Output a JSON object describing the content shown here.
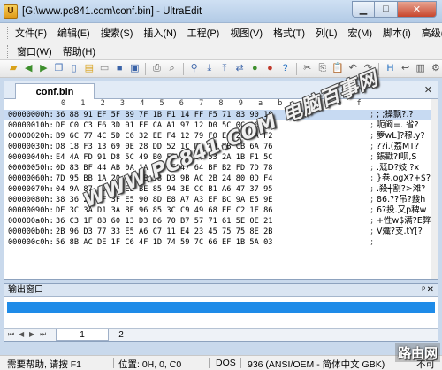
{
  "window": {
    "title": "[G:\\www.pc841.com\\conf.bin] - UltraEdit"
  },
  "menus": {
    "row1": [
      "文件(F)",
      "编辑(E)",
      "搜索(S)",
      "插入(N)",
      "工程(P)",
      "视图(V)",
      "格式(T)",
      "列(L)",
      "宏(M)",
      "脚本(i)",
      "高级(A)"
    ],
    "row2": [
      "窗口(W)",
      "帮助(H)"
    ]
  },
  "document": {
    "tab_label": "conf.bin",
    "ruler": [
      "0",
      "1",
      "2",
      "3",
      "4",
      "5",
      "6",
      "7",
      "8",
      "9",
      "a",
      "b",
      "c",
      "d",
      "e",
      "f"
    ],
    "rows": [
      {
        "addr": "00000000h:",
        "bytes": "36 88 91 EF 5F 89 7F 1B F1 14 FF F5 71 83 90 18",
        "ascii": "; ;操飘?.?"
      },
      {
        "addr": "00000010h:",
        "bytes": "DF C0 C3 F6 3D 01 FF CA A1 97 12 D0 5C 0C A6 32",
        "ascii": "呃阚=. 省?"
      },
      {
        "addr": "00000020h:",
        "bytes": "B9 6C 77 4C 5D C6 32 EE F4 12 79 F0 EC 20 6A F2",
        "ascii": "箩wL]?穆.y?"
      },
      {
        "addr": "00000030h:",
        "bytes": "D8 18 F3 13 69 0E 28 DD 52 1C D9 4D DB CB 6A 76",
        "ascii": "??i.(荔MT?"
      },
      {
        "addr": "00000040h:",
        "bytes": "E4 4A FD 91 D8 5C 49 B0 FB 4E 2C 53 2A 1B F1 5C",
        "ascii": "鋹戳?I呗,S"
      },
      {
        "addr": "00000050h:",
        "bytes": "0D 83 BF 44 AB 0A 1A 8E CE 47 64 BF B2 FD 7D 78",
        "ascii": ".兓D?妓 ?x"
      },
      {
        "addr": "00000060h:",
        "bytes": "7D 95 BB 1A 20 56 8B 58 D3 9B AC 2B 24 80 0D F4",
        "ascii": "}卷.ogX?+$?"
      },
      {
        "addr": "00000070h:",
        "bytes": "04 9A 87 A9 A8 EE BE 85 94 3E CC B1 A6 47 37 95",
        "ascii": ".殺┽割?>滩?"
      },
      {
        "addr": "00000080h:",
        "bytes": "38 36 2E 3F 3F E5 90 8D E8 A7 A3 EF BC 9A E5 9E",
        "ascii": "86.??吊?鼗h"
      },
      {
        "addr": "00000090h:",
        "bytes": "DE 3C 3A D1 3A 8E 96 85 3C C9 49 68 EE C2 1F 86",
        "ascii": "6?投.又p稗w"
      },
      {
        "addr": "000000a0h:",
        "bytes": "36 C3 1F 88 60 13 D3 D6 70 B7 57 71 61 5E 0E 21",
        "ascii": "+性w$满?E弊"
      },
      {
        "addr": "000000b0h:",
        "bytes": "2B 96 D3 77 33 E5 A6 C7 11 E4 23 45 75 75 8E 2B",
        "ascii": "V殲?支.tY[?"
      },
      {
        "addr": "000000c0h:",
        "bytes": "56 8B AC DE 1F C6 4F 1D 74 59 7C 66 EF 1B 5A 03",
        "ascii": ""
      }
    ]
  },
  "watermark": "WWW.PC841.COM 电脑百事网",
  "output": {
    "title": "输出窗口",
    "tabs": [
      "1",
      "2"
    ]
  },
  "status": {
    "help": "需要帮助, 请按 F1",
    "position": "位置: 0H, 0, C0",
    "format": "DOS",
    "codepage": "936  (ANSI/OEM - 简体中文 GBK)",
    "mode": "不可"
  },
  "corner_logo": "路由网"
}
